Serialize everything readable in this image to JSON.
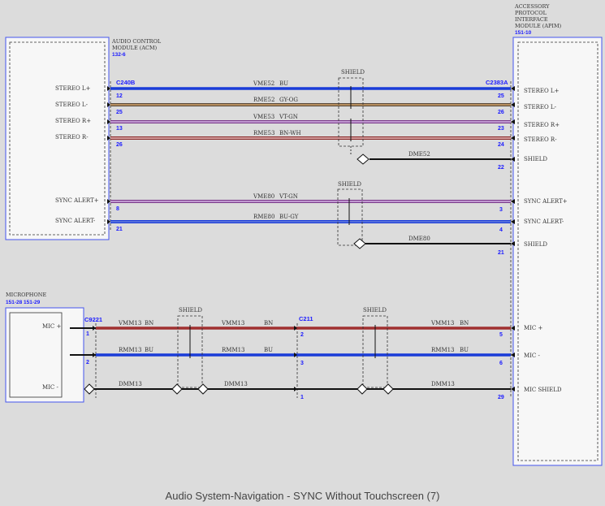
{
  "caption": "Audio System-Navigation - SYNC Without Touchscreen (7)",
  "colors": {
    "blue": "#1a1aff",
    "wire_blue": "#1a3cd8",
    "wire_red": "#a03030",
    "wire_black": "#111111"
  },
  "acm": {
    "name_lines": [
      "AUDIO CONTROL",
      "MODULE (ACM)"
    ],
    "ref": "132-6",
    "connector": "C240B",
    "pins": [
      {
        "label": "STEREO L+",
        "pin": "12"
      },
      {
        "label": "STEREO L-",
        "pin": "25"
      },
      {
        "label": "STEREO R+",
        "pin": "13"
      },
      {
        "label": "STEREO R-",
        "pin": "26"
      },
      {
        "label": "SYNC ALERT+",
        "pin": "8"
      },
      {
        "label": "SYNC ALERT-",
        "pin": "21"
      }
    ]
  },
  "apim": {
    "name_lines": [
      "ACCESSORY",
      "PROTOCOL",
      "INTERFACE",
      "MODULE (APIM)"
    ],
    "ref": "151-10",
    "connector": "C2383A",
    "pins": [
      {
        "label": "STEREO L+",
        "pin": "25"
      },
      {
        "label": "STEREO L-",
        "pin": "26"
      },
      {
        "label": "STEREO R+",
        "pin": "23"
      },
      {
        "label": "STEREO R-",
        "pin": "24"
      },
      {
        "label": "SHIELD",
        "pin": "22"
      },
      {
        "label": "SYNC ALERT+",
        "pin": "3"
      },
      {
        "label": "SYNC ALERT-",
        "pin": "4"
      },
      {
        "label": "SHIELD",
        "pin": "21"
      },
      {
        "label": "MIC +",
        "pin": "5"
      },
      {
        "label": "MIC -",
        "pin": "6"
      },
      {
        "label": "MIC SHIELD",
        "pin": "29"
      }
    ]
  },
  "microphone": {
    "name": "MICROPHONE",
    "ref": "151-28   151-29",
    "pins": [
      {
        "label": "MIC +",
        "pin": "1"
      },
      {
        "label": "MIC -",
        "pin": "2"
      }
    ]
  },
  "wires": [
    {
      "circuit": "VME52",
      "color": "BU"
    },
    {
      "circuit": "RME52",
      "color": "GY-OG"
    },
    {
      "circuit": "VME53",
      "color": "VT-GN"
    },
    {
      "circuit": "RME53",
      "color": "BN-WH"
    },
    {
      "circuit": "DME52",
      "color": ""
    },
    {
      "circuit": "VME80",
      "color": "VT-GN"
    },
    {
      "circuit": "RME80",
      "color": "BU-GY"
    },
    {
      "circuit": "DME80",
      "color": ""
    },
    {
      "circuit": "VMM13",
      "color": "BN"
    },
    {
      "circuit": "RMM13",
      "color": "BU"
    },
    {
      "circuit": "DMM13",
      "color": ""
    }
  ],
  "shield_label": "SHIELD",
  "inline_connectors": {
    "c9221": "C9221",
    "c211": "C211"
  },
  "c211_pins": [
    "2",
    "3",
    "1"
  ]
}
